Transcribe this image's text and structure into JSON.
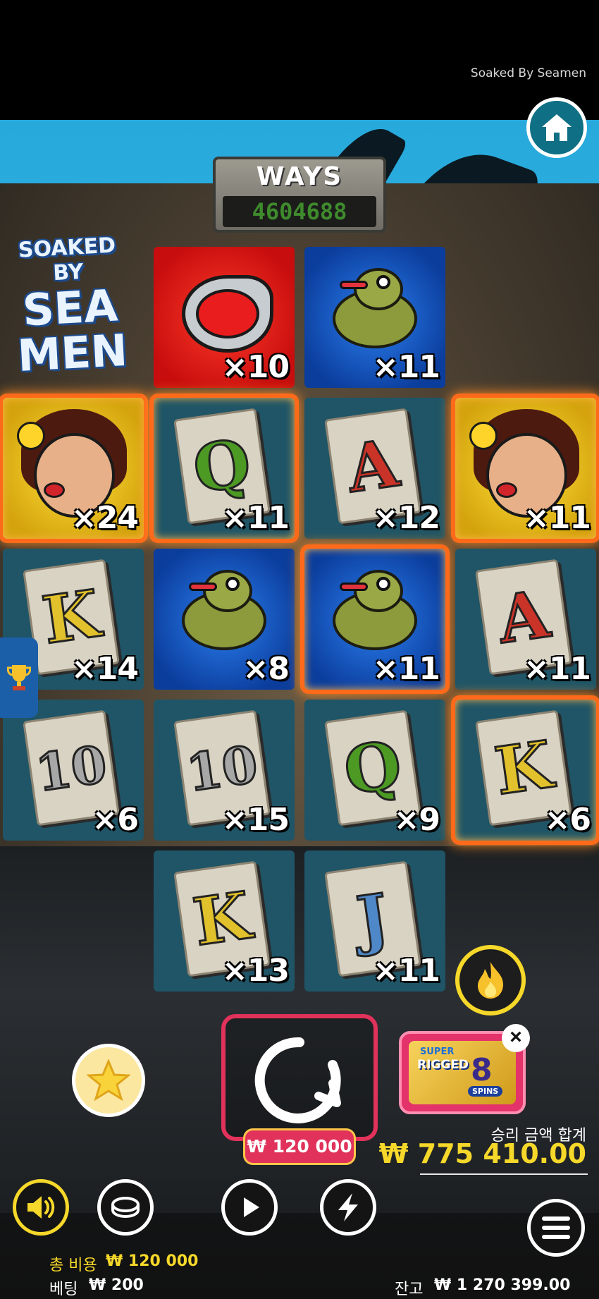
{
  "header": {
    "game_title": "Soaked By Seamen"
  },
  "ways": {
    "label": "WAYS",
    "value": "4604688"
  },
  "logo": {
    "line1": "SOAKED BY",
    "line2": "SEA",
    "line3": "MEN"
  },
  "grid": {
    "cells": [
      {
        "symbol": "snake",
        "multiplier": "×10",
        "win": false
      },
      {
        "symbol": "frog",
        "multiplier": "×11",
        "win": false
      },
      {
        "symbol": "lady",
        "multiplier": "×24",
        "win": true
      },
      {
        "symbol": "Q",
        "multiplier": "×11",
        "win": true
      },
      {
        "symbol": "A",
        "multiplier": "×12",
        "win": false
      },
      {
        "symbol": "lady",
        "multiplier": "×11",
        "win": true
      },
      {
        "symbol": "K",
        "multiplier": "×14",
        "win": false
      },
      {
        "symbol": "frog",
        "multiplier": "×8",
        "win": false
      },
      {
        "symbol": "frog",
        "multiplier": "×11",
        "win": true
      },
      {
        "symbol": "A",
        "multiplier": "×11",
        "win": false
      },
      {
        "symbol": "10",
        "multiplier": "×6",
        "win": false
      },
      {
        "symbol": "10",
        "multiplier": "×15",
        "win": false
      },
      {
        "symbol": "Q",
        "multiplier": "×9",
        "win": false
      },
      {
        "symbol": "K",
        "multiplier": "×6",
        "win": true
      },
      {
        "symbol": "K",
        "multiplier": "×13",
        "win": false
      },
      {
        "symbol": "J",
        "multiplier": "×11",
        "win": false
      }
    ]
  },
  "spin": {
    "cost": "₩ 120 000"
  },
  "promo": {
    "line1": "SUPER",
    "line2": "RIGGED",
    "number": "8",
    "line3": "SPINS",
    "close": "×"
  },
  "win": {
    "label": "승리 금액 합계",
    "value": "₩ 775 410.00"
  },
  "footer": {
    "total_cost_label": "총 비용",
    "total_cost_value": "₩ 120 000",
    "bet_label": "베팅",
    "bet_value": "₩ 200",
    "balance_label": "잔고",
    "balance_value": "₩ 1 270 399.00"
  },
  "colors": {
    "accent": "#e0325a",
    "highlight": "#f6d82a",
    "win_border": "#ff6a1a",
    "sky": "#31b7e6"
  },
  "icons": [
    "home-icon",
    "trophy-icon",
    "fire-icon",
    "star-icon",
    "spin-icon",
    "sound-icon",
    "coin-icon",
    "play-icon",
    "lightning-icon",
    "menu-icon"
  ]
}
